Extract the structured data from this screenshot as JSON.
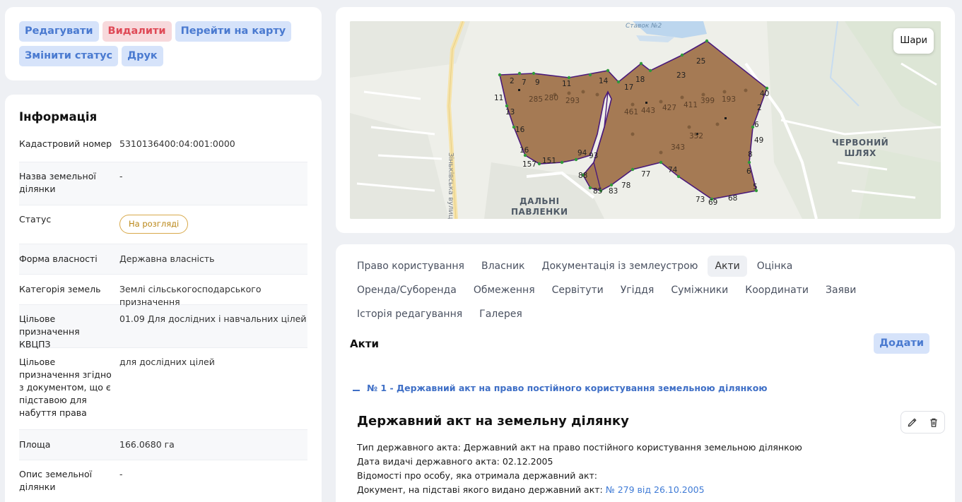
{
  "actions": {
    "edit": "Редагувати",
    "delete": "Видалити",
    "goto_map": "Перейти на карту",
    "change_status": "Змінити статус",
    "print": "Друк"
  },
  "info": {
    "title": "Інформація",
    "rows": [
      {
        "label": "Кадастровий номер",
        "value": "5310136400:04:001:0000"
      },
      {
        "label": "Назва земельної ділянки",
        "value": "-"
      },
      {
        "label": "Статус",
        "value": "На розгляді"
      },
      {
        "label": "Форма власності",
        "value": "Державна власність"
      },
      {
        "label": "Категорія земель",
        "value": "Землі сільськогосподарського призначення"
      },
      {
        "label": "Цільове призначення КВЦПЗ",
        "value": "01.09 Для дослідних і навчальних цілей"
      },
      {
        "label": "Цільове призначення згідно з документом, що є підставою для набуття права",
        "value": "для дослідних цілей"
      },
      {
        "label": "Площа",
        "value": "166.0680 га"
      },
      {
        "label": "Опис земельної ділянки",
        "value": "-"
      }
    ],
    "status_color": "#d8a94a"
  },
  "map": {
    "layers_label": "Шари",
    "labels": {
      "district_1": "ДАЛЬНІ\nПАВЛЕНКИ",
      "district_2": "ЧЕРВОНИЙ\nШЛЯХ",
      "street": "Зіньківська вулиця",
      "water": "Ставок №2"
    },
    "parcel_fill": "#9b6a3f",
    "parcel_stroke": "#4a1a7a",
    "vertex_numbers": [
      "2",
      "7",
      "9",
      "11",
      "14",
      "17",
      "18",
      "23",
      "25",
      "40",
      "2",
      "6",
      "49",
      "8",
      "6",
      "5",
      "68",
      "69",
      "73",
      "74",
      "77",
      "78",
      "83",
      "85",
      "88",
      "93",
      "94",
      "151",
      "157",
      "16",
      "16",
      "13",
      "11",
      "280",
      "285",
      "293",
      "461",
      "443",
      "427",
      "411",
      "399",
      "393",
      "343",
      "352"
    ]
  },
  "details": {
    "tabs": [
      {
        "label": "Право користування",
        "active": false
      },
      {
        "label": "Власник",
        "active": false
      },
      {
        "label": "Документація із землеустрою",
        "active": false
      },
      {
        "label": "Акти",
        "active": true
      },
      {
        "label": "Оцінка",
        "active": false
      },
      {
        "label": "Оренда/Суборенда",
        "active": false
      },
      {
        "label": "Обмеження",
        "active": false
      },
      {
        "label": "Сервітути",
        "active": false
      },
      {
        "label": "Угіддя",
        "active": false
      },
      {
        "label": "Суміжники",
        "active": false
      },
      {
        "label": "Координати",
        "active": false
      },
      {
        "label": "Заяви",
        "active": false
      },
      {
        "label": "Історія редагування",
        "active": false
      },
      {
        "label": "Галерея",
        "active": false
      }
    ],
    "acts_title": "Акти",
    "add_label": "Додати",
    "act_link": "№ 1 - Державний акт на право постійного користування земельною ділянкою",
    "act_title": "Державний акт на земельну ділянку",
    "act_type_label": "Тип державного акта:",
    "act_type_value": "Державний акт на право постійного користування земельною ділянкою",
    "issue_date_label": "Дата видачі державного акта:",
    "issue_date_value": "02.12.2005",
    "person_label": "Відомості про особу, яка отримала державний акт:",
    "document_label": "Документ, на підставі якого видано державний акт:",
    "document_link": "№ 279 від 26.10.2005"
  }
}
